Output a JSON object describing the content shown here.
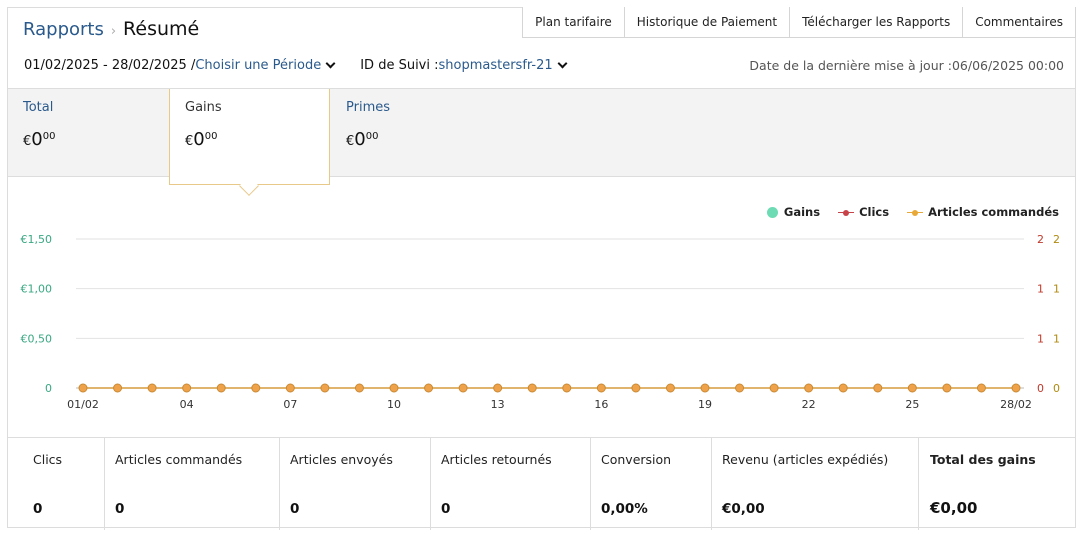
{
  "breadcrumb": {
    "parent": "Rapports",
    "separator": "›",
    "current": "Résumé"
  },
  "top_tabs": [
    "Plan tarifaire",
    "Historique de Paiement",
    "Télécharger les Rapports",
    "Commentaires"
  ],
  "filters": {
    "date_range": "01/02/2025 - 28/02/2025 /",
    "period_link": "Choisir une Période",
    "tracking_label": "ID de Suivi :",
    "tracking_id": "shopmastersfr-21"
  },
  "last_updated": "Date de la dernière mise à jour :06/06/2025 00:00",
  "metrics": [
    {
      "label": "Total",
      "currency": "€",
      "int": "0",
      "dec": "00"
    },
    {
      "label": "Gains",
      "currency": "€",
      "int": "0",
      "dec": "00"
    },
    {
      "label": "Primes",
      "currency": "€",
      "int": "0",
      "dec": "00"
    }
  ],
  "legend": [
    {
      "label": "Gains",
      "color": "#6ddbb4"
    },
    {
      "label": "Clics",
      "color": "#c8424a"
    },
    {
      "label": "Articles commandés",
      "color": "#e8a838"
    }
  ],
  "chart_data": {
    "type": "line",
    "x": [
      "01/02",
      "02/02",
      "03/02",
      "04/02",
      "05/02",
      "06/02",
      "07/02",
      "08/02",
      "09/02",
      "10/02",
      "11/02",
      "12/02",
      "13/02",
      "14/02",
      "15/02",
      "16/02",
      "17/02",
      "18/02",
      "19/02",
      "20/02",
      "21/02",
      "22/02",
      "23/02",
      "24/02",
      "25/02",
      "26/02",
      "27/02",
      "28/02"
    ],
    "x_tick_labels": [
      "01/02",
      "04",
      "07",
      "10",
      "13",
      "16",
      "19",
      "22",
      "25",
      "28/02"
    ],
    "x_tick_indices": [
      0,
      3,
      6,
      9,
      12,
      15,
      18,
      21,
      24,
      27
    ],
    "y_left": {
      "ticks": [
        "0",
        "€0,50",
        "€1,00",
        "€1,50"
      ],
      "tick_values": [
        0,
        0.5,
        1,
        1.5
      ],
      "ylim": [
        0,
        1.5
      ],
      "color": "#3aa882"
    },
    "y_right_1": {
      "ticks": [
        "0",
        "1",
        "1",
        "2"
      ],
      "color": "#c0392b"
    },
    "y_right_2": {
      "ticks": [
        "0",
        "1",
        "1",
        "2"
      ],
      "color": "#b08a10"
    },
    "series": [
      {
        "name": "Gains",
        "values": [
          0,
          0,
          0,
          0,
          0,
          0,
          0,
          0,
          0,
          0,
          0,
          0,
          0,
          0,
          0,
          0,
          0,
          0,
          0,
          0,
          0,
          0,
          0,
          0,
          0,
          0,
          0,
          0
        ]
      },
      {
        "name": "Clics",
        "values": [
          0,
          0,
          0,
          0,
          0,
          0,
          0,
          0,
          0,
          0,
          0,
          0,
          0,
          0,
          0,
          0,
          0,
          0,
          0,
          0,
          0,
          0,
          0,
          0,
          0,
          0,
          0,
          0
        ]
      },
      {
        "name": "Articles commandés",
        "values": [
          0,
          0,
          0,
          0,
          0,
          0,
          0,
          0,
          0,
          0,
          0,
          0,
          0,
          0,
          0,
          0,
          0,
          0,
          0,
          0,
          0,
          0,
          0,
          0,
          0,
          0,
          0,
          0
        ]
      }
    ],
    "grid": true,
    "legend_position": "top-right"
  },
  "stats": [
    {
      "label": "Clics",
      "value": "0"
    },
    {
      "label": "Articles commandés",
      "value": "0"
    },
    {
      "label": "Articles envoyés",
      "value": "0"
    },
    {
      "label": "Articles retournés",
      "value": "0"
    },
    {
      "label": "Conversion",
      "value": "0,00%"
    },
    {
      "label": "Revenu (articles expédiés)",
      "value": "€0,00"
    },
    {
      "label": "Total des gains",
      "value": "€0,00"
    }
  ]
}
